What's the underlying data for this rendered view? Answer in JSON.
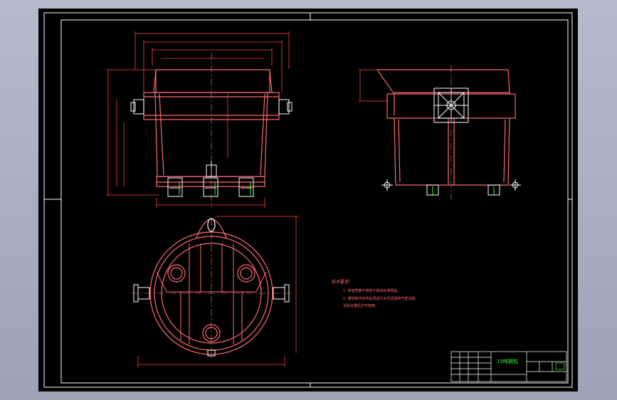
{
  "drawing": {
    "title_block": {
      "drawing_name": "15吨钢包"
    },
    "technical_requirements": {
      "heading": "技术要求：",
      "items": [
        "1. 焊缝质量不得低于相关标准规定。",
        "2. 钢包制作完毕后须进行水压试验和气密试验，",
        "   试验合格后方可使用。"
      ]
    }
  },
  "colors": {
    "outline": "#ff6b6b",
    "dimension": "#ff4040",
    "centerline": "#ff8080",
    "detail": "#ffffff",
    "accent": "#3cff3c",
    "frame": "#ffffff"
  }
}
